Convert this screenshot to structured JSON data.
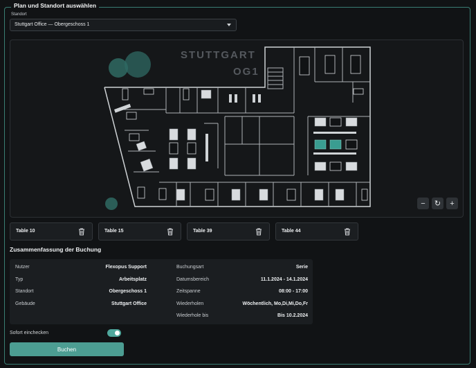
{
  "section": {
    "title": "Plan und Standort auswählen"
  },
  "location": {
    "label": "Standort",
    "value": "Stuttgart Office — Obergeschoss 1"
  },
  "map": {
    "title_line1": "STUTTGART",
    "title_line2": "OG1"
  },
  "zoom_controls": {
    "zoom_out": "−",
    "reset": "↻",
    "zoom_in": "+"
  },
  "tables": [
    {
      "label": "Table 10"
    },
    {
      "label": "Table 15"
    },
    {
      "label": "Table 39"
    },
    {
      "label": "Table 44"
    }
  ],
  "summary": {
    "title": "Zusammenfassung der Buchung",
    "left": [
      {
        "key": "Nutzer",
        "value": "Flexopus Support"
      },
      {
        "key": "Typ",
        "value": "Arbeitsplatz"
      },
      {
        "key": "Standort",
        "value": "Obergeschoss 1"
      },
      {
        "key": "Gebäude",
        "value": "Stuttgart Office"
      }
    ],
    "right": [
      {
        "key": "Buchungsart",
        "value": "Serie"
      },
      {
        "key": "Datumsbereich",
        "value": "11.1.2024 - 14.1.2024"
      },
      {
        "key": "Zeitspanne",
        "value": "08:00 - 17:00"
      },
      {
        "key": "Wiederholen",
        "value": "Wöchentlich, Mo,Di,Mi,Do,Fr"
      },
      {
        "key": "Wiederhole bis",
        "value": "Bis 10.2.2024"
      }
    ]
  },
  "checkin": {
    "label": "Sofort einchecken",
    "enabled": true
  },
  "submit": {
    "label": "Buchen"
  },
  "colors": {
    "accent": "#4fa79c",
    "border": "#3a7e74",
    "background": "#111315"
  },
  "icons": [
    "chevron-down-icon",
    "trash-icon",
    "minus-icon",
    "reset-icon",
    "plus-icon"
  ]
}
